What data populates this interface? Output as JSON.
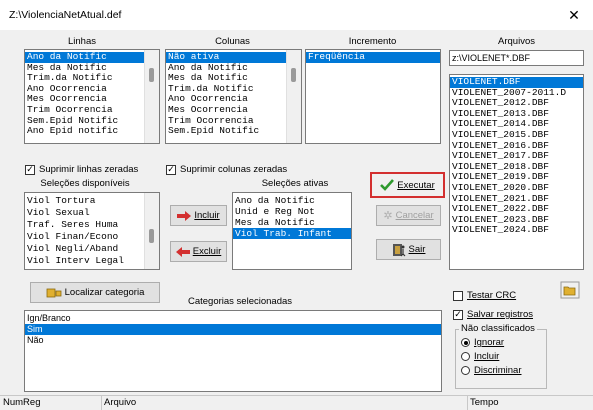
{
  "window": {
    "title": "Z:\\ViolenciaNetAtual.def",
    "close_glyph": "✕"
  },
  "linhas": {
    "header": "Linhas",
    "items": [
      "Ano da Notific",
      "Mes da Notific",
      "Trim.da Notific",
      "Ano Ocorrencia",
      "Mes Ocorrencia",
      "Trim Ocorrencia",
      "Sem.Epid Notific",
      "Ano Epid notific"
    ],
    "selected_index": 0
  },
  "colunas": {
    "header": "Colunas",
    "items": [
      "Não ativa",
      "Ano da Notific",
      "Mes da Notific",
      "Trim.da Notific",
      "Ano Ocorrencia",
      "Mes Ocorrencia",
      "Trim Ocorrencia",
      "Sem.Epid Notific"
    ],
    "selected_index": 0
  },
  "incremento": {
    "header": "Incremento",
    "items": [
      "Freqüência"
    ],
    "selected_index": 0
  },
  "arquivos": {
    "header": "Arquivos",
    "filter_value": "z:\\VIOLENET*.DBF",
    "items": [
      "VIOLENET.DBF",
      "VIOLENET_2007-2011.D",
      "VIOLENET_2012.DBF",
      "VIOLENET_2013.DBF",
      "VIOLENET_2014.DBF",
      "VIOLENET_2015.DBF",
      "VIOLENET_2016.DBF",
      "VIOLENET_2017.DBF",
      "VIOLENET_2018.DBF",
      "VIOLENET_2019.DBF",
      "VIOLENET_2020.DBF",
      "VIOLENET_2021.DBF",
      "VIOLENET_2022.DBF",
      "VIOLENET_2023.DBF",
      "VIOLENET_2024.DBF"
    ],
    "selected_index": 0
  },
  "options": {
    "suprimir_linhas": "Suprimir linhas zeradas",
    "suprimir_linhas_checked": true,
    "suprimir_colunas": "Suprimir colunas zeradas",
    "suprimir_colunas_checked": true
  },
  "selecoes_disponiveis": {
    "header": "Seleções disponíveis",
    "items": [
      "Viol Tortura",
      "Viol Sexual",
      "Traf. Seres Huma",
      "Viol Finan/Econo",
      "Viol Negli/Aband",
      "Viol Interv Legal"
    ]
  },
  "selecoes_ativas": {
    "header": "Seleções ativas",
    "items": [
      "Ano da Notific",
      "Unid e Reg Not",
      "Mes da Notific",
      "Viol Trab. Infant"
    ],
    "selected_index": 3
  },
  "buttons": {
    "incluir": "Incluir",
    "excluir": "Excluir",
    "executar": "Executar",
    "cancelar": "Cancelar",
    "sair": "Sair",
    "localizar": "Localizar categoria"
  },
  "categorias": {
    "header": "Categorias selecionadas",
    "items": [
      "Ign/Branco",
      "Sim",
      "Não"
    ],
    "selected_index": 1
  },
  "right_options": {
    "testar_crc": "Testar CRC",
    "testar_crc_checked": false,
    "salvar_registros": "Salvar registros",
    "salvar_registros_checked": true,
    "nao_classificados": "Não classificados",
    "radios": [
      "Ignorar",
      "Incluir",
      "Discriminar"
    ],
    "radio_selected": 0
  },
  "status": {
    "numreg": "NumReg",
    "arquivo": "Arquivo",
    "tempo": "Tempo"
  },
  "colors": {
    "selection": "#0078d7",
    "exec_border": "#d32f2f",
    "check_green": "#2e9a2e",
    "arrow_red": "#d32f2f"
  }
}
